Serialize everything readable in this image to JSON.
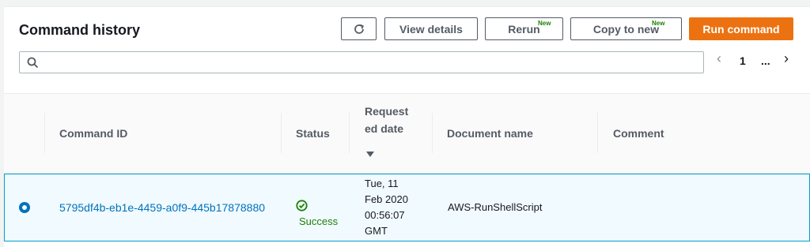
{
  "header": {
    "title": "Command history",
    "buttons": {
      "view_details": "View details",
      "rerun": "Rerun",
      "rerun_badge": "New",
      "copy_to_new": "Copy to new",
      "copy_badge": "New",
      "run_command": "Run command"
    }
  },
  "search": {
    "value": "",
    "placeholder": ""
  },
  "pagination": {
    "current_page": "1",
    "ellipsis": "..."
  },
  "table": {
    "columns": {
      "command_id": "Command ID",
      "status": "Status",
      "requested_date_line1": "Request",
      "requested_date_line2": "ed date",
      "document_name": "Document name",
      "comment": "Comment"
    },
    "rows": [
      {
        "command_id": "5795df4b-eb1e-4459-a0f9-445b17878880",
        "status": "Success",
        "date_line1": "Tue, 11",
        "date_line2": "Feb 2020",
        "date_line3": "00:56:07",
        "date_line4": "GMT",
        "document_name": "AWS-RunShellScript",
        "comment": ""
      }
    ]
  },
  "colors": {
    "primary": "#ec7211",
    "link": "#0073bb",
    "success": "#1d8102",
    "selected_row": "#f1faff"
  },
  "icons": [
    "refresh-icon",
    "search-icon",
    "chevron-left-icon",
    "chevron-right-icon",
    "sort-desc-icon",
    "success-icon"
  ]
}
